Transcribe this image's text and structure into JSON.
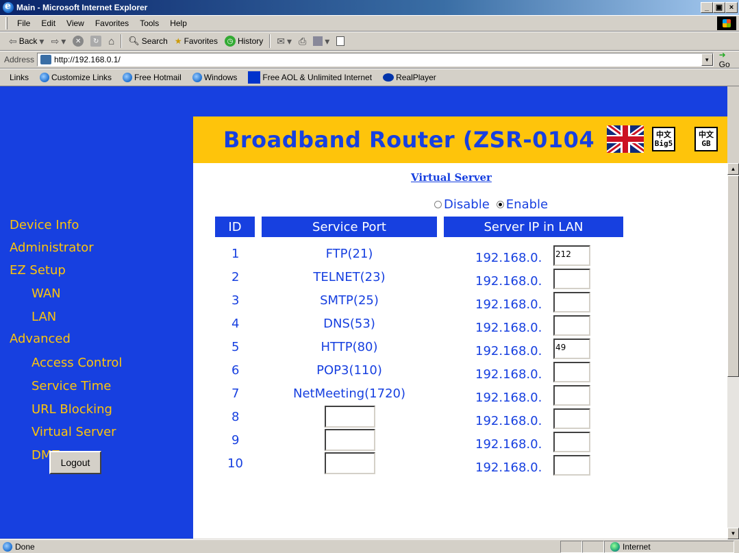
{
  "window": {
    "title": "Main - Microsoft Internet Explorer",
    "min": "_",
    "max": "ð",
    "close": "×"
  },
  "menu": [
    "File",
    "Edit",
    "View",
    "Favorites",
    "Tools",
    "Help"
  ],
  "toolbar": {
    "back": "Back",
    "search": "Search",
    "favorites": "Favorites",
    "history": "History"
  },
  "address": {
    "label": "Address",
    "url": "http://192.168.0.1/",
    "go": "Go"
  },
  "links": {
    "label": "Links",
    "items": [
      "Customize Links",
      "Free Hotmail",
      "Windows",
      "Free AOL & Unlimited Internet",
      "RealPlayer"
    ]
  },
  "banner": {
    "title": "Broadband Router (ZSR-0104",
    "big5_top": "中文",
    "big5_bottom": "Big5",
    "gb_top": "中文",
    "gb_bottom": "GB"
  },
  "nav": {
    "device_info": "Device Info",
    "administrator": "Administrator",
    "ez_setup": "EZ Setup",
    "wan": "WAN",
    "lan": "LAN",
    "advanced": "Advanced",
    "access_control": "Access Control",
    "service_time": "Service Time",
    "url_blocking": "URL Blocking",
    "virtual_server": "Virtual Server",
    "dmz": "DMZ",
    "logout": "Logout"
  },
  "form": {
    "title": "Virtual Server",
    "disable": "Disable",
    "enable": "Enable",
    "selected": "Enable",
    "headers": {
      "id": "ID",
      "service_port": "Service Port",
      "server_ip": "Server IP in LAN"
    },
    "rows": [
      {
        "id": "1",
        "service": "FTP(21)",
        "ip_prefix": "192.168.0.",
        "ip_value": "212"
      },
      {
        "id": "2",
        "service": "TELNET(23)",
        "ip_prefix": "192.168.0.",
        "ip_value": ""
      },
      {
        "id": "3",
        "service": "SMTP(25)",
        "ip_prefix": "192.168.0.",
        "ip_value": ""
      },
      {
        "id": "4",
        "service": "DNS(53)",
        "ip_prefix": "192.168.0.",
        "ip_value": ""
      },
      {
        "id": "5",
        "service": "HTTP(80)",
        "ip_prefix": "192.168.0.",
        "ip_value": "49"
      },
      {
        "id": "6",
        "service": "POP3(110)",
        "ip_prefix": "192.168.0.",
        "ip_value": ""
      },
      {
        "id": "7",
        "service": "NetMeeting(1720)",
        "ip_prefix": "192.168.0.",
        "ip_value": ""
      },
      {
        "id": "8",
        "service": "",
        "ip_prefix": "192.168.0.",
        "ip_value": ""
      },
      {
        "id": "9",
        "service": "",
        "ip_prefix": "192.168.0.",
        "ip_value": ""
      },
      {
        "id": "10",
        "service": "",
        "ip_prefix": "192.168.0.",
        "ip_value": ""
      }
    ]
  },
  "status": {
    "text": "Done",
    "zone": "Internet"
  }
}
